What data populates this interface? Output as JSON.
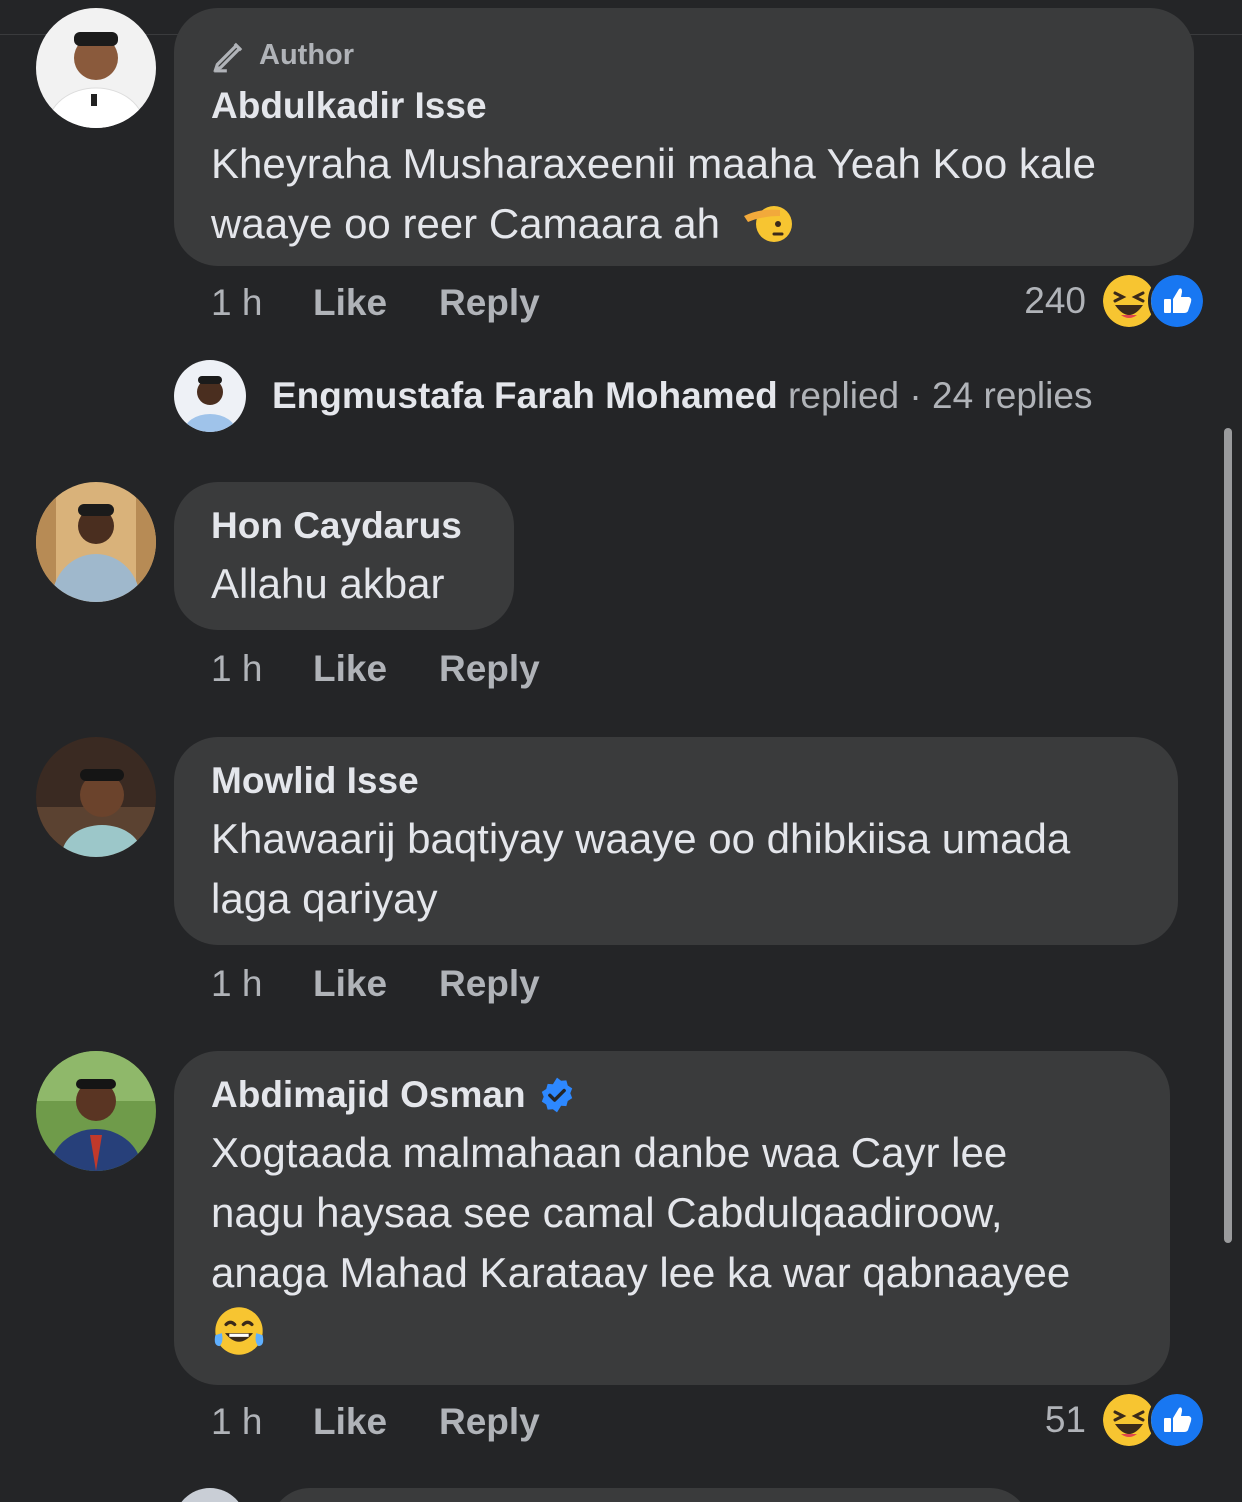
{
  "thread": {
    "replies_summary": {
      "name": "Engmustafa Farah Mohamed",
      "verb": "replied",
      "separator": "·",
      "count_text": "24 replies"
    }
  },
  "comments": [
    {
      "author_badge": "Author",
      "name": "Abdulkadir Isse",
      "text_line1": "Kheyraha Musharaxeenii maaha Yeah Koo kale",
      "text_line2": "waaye oo reer Camaara ah",
      "emoji": "saluting-face",
      "time": "1 h",
      "like": "Like",
      "reply": "Reply",
      "reaction_count": "240"
    },
    {
      "name": "Hon Caydarus",
      "text_line1": "Allahu akbar",
      "time": "1 h",
      "like": "Like",
      "reply": "Reply"
    },
    {
      "name": "Mowlid Isse",
      "text_line1": "Khawaarij baqtiyay waaye oo dhibkiisa umada",
      "text_line2": "laga qariyay",
      "time": "1 h",
      "like": "Like",
      "reply": "Reply"
    },
    {
      "name": "Abdimajid Osman",
      "verified": true,
      "text_line1": "Xogtaada malmahaan danbe waa Cayr lee",
      "text_line2": "nagu haysaa see camal Cabdulqaadiroow,",
      "text_line3": "anaga Mahad Karataay lee ka war qabnaayee",
      "emoji": "face-with-tears-of-joy",
      "time": "1 h",
      "like": "Like",
      "reply": "Reply",
      "reaction_count": "51"
    }
  ],
  "colors": {
    "background": "#242527",
    "bubble": "#3a3b3c",
    "primary_text": "#e4e6eb",
    "secondary_text": "#b0b3b8",
    "like_blue": "#1877f2",
    "verified_blue": "#2d88ff"
  }
}
